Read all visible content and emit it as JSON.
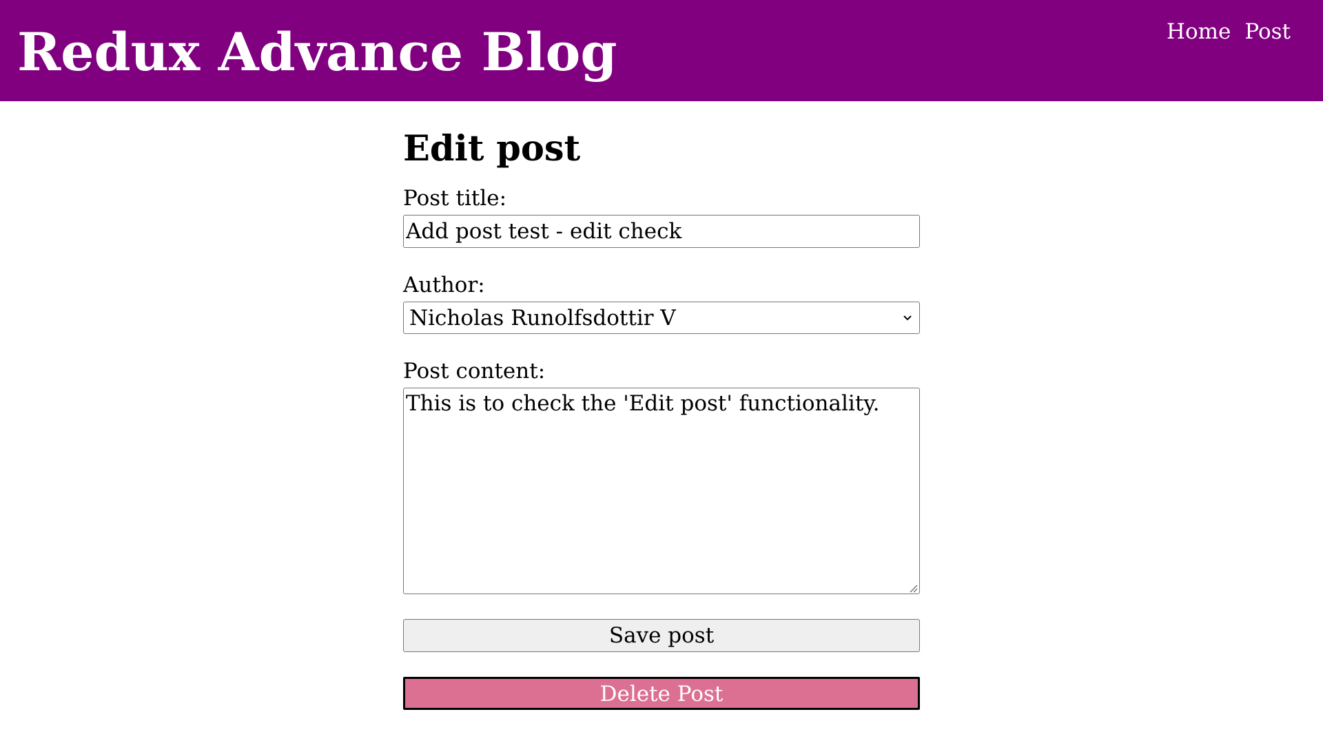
{
  "header": {
    "site_title": "Redux Advance Blog",
    "nav": [
      {
        "label": "Home"
      },
      {
        "label": "Post"
      }
    ]
  },
  "main": {
    "page_title": "Edit post",
    "form": {
      "title_label": "Post title:",
      "title_value": "Add post test - edit check",
      "author_label": "Author:",
      "author_selected": "Nicholas Runolfsdottir V",
      "content_label": "Post content:",
      "content_value": "This is to check the 'Edit post' functionality.",
      "save_label": "Save post",
      "delete_label": "Delete Post"
    }
  },
  "colors": {
    "header_bg": "#800080",
    "delete_bg": "#db7093",
    "save_bg": "#efefef"
  },
  "icons": {
    "select_indicator": "chevron-down-icon",
    "textarea_resize": "resize-handle-icon"
  }
}
